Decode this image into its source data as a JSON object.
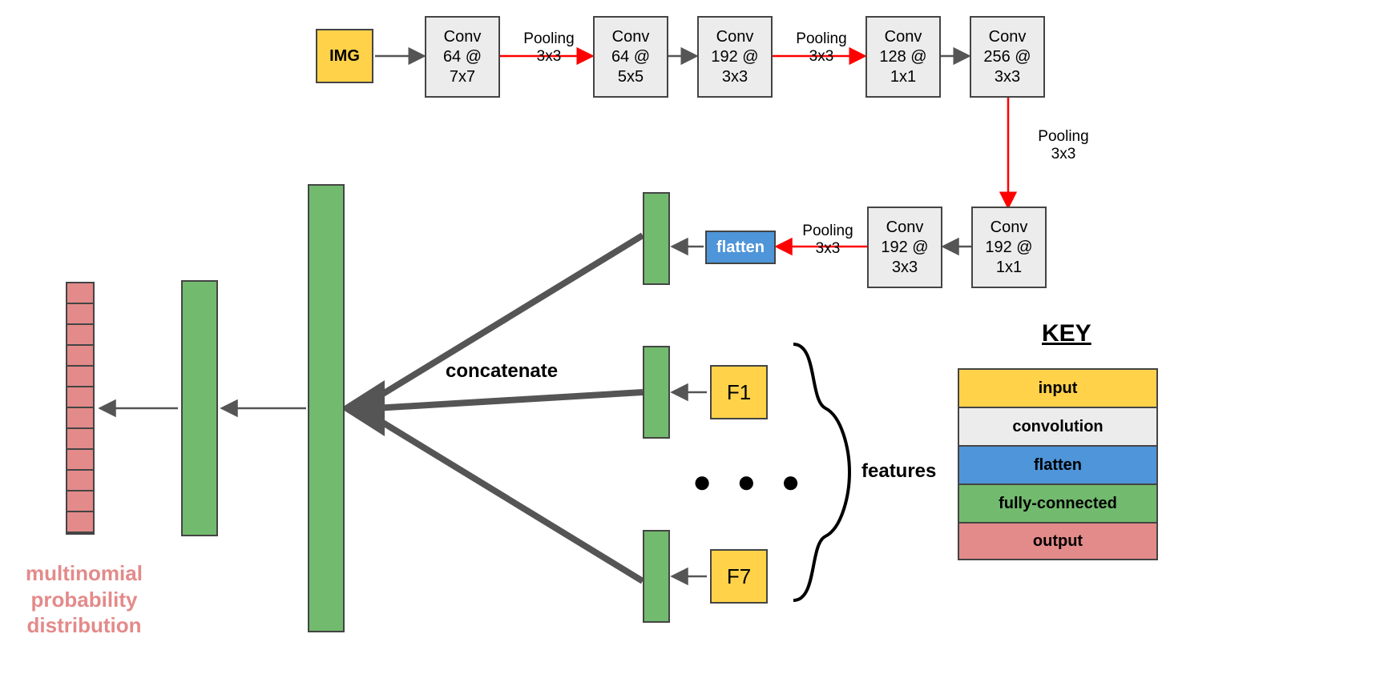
{
  "top": {
    "img": "IMG",
    "conv1": "Conv\n64 @\n7x7",
    "pool1": "Pooling\n3x3",
    "conv2": "Conv\n64 @\n5x5",
    "conv3": "Conv\n192 @\n3x3",
    "pool2": "Pooling\n3x3",
    "conv4": "Conv\n128 @\n1x1",
    "conv5": "Conv\n256 @\n3x3",
    "pool3": "Pooling\n3x3",
    "conv6": "Conv\n192 @\n1x1",
    "conv7": "Conv\n192 @\n3x3",
    "pool4": "Pooling\n3x3",
    "flatten": "flatten"
  },
  "mid": {
    "concat": "concatenate",
    "f1": "F1",
    "f7": "F7",
    "features": "features",
    "ellipsis": "● ● ●"
  },
  "out": {
    "label": "multinomial\nprobability\ndistribution"
  },
  "key": {
    "title": "KEY",
    "input": "input",
    "conv": "convolution",
    "flatten": "flatten",
    "fc": "fully-connected",
    "output": "output"
  },
  "colors": {
    "input": "#ffd24a",
    "conv": "#ececec",
    "flatten": "#4e95d9",
    "fc": "#72ba6e",
    "output": "#e38a8a",
    "arrow": "#555555",
    "arrowRed": "#ff0000",
    "thick": "#555555"
  }
}
